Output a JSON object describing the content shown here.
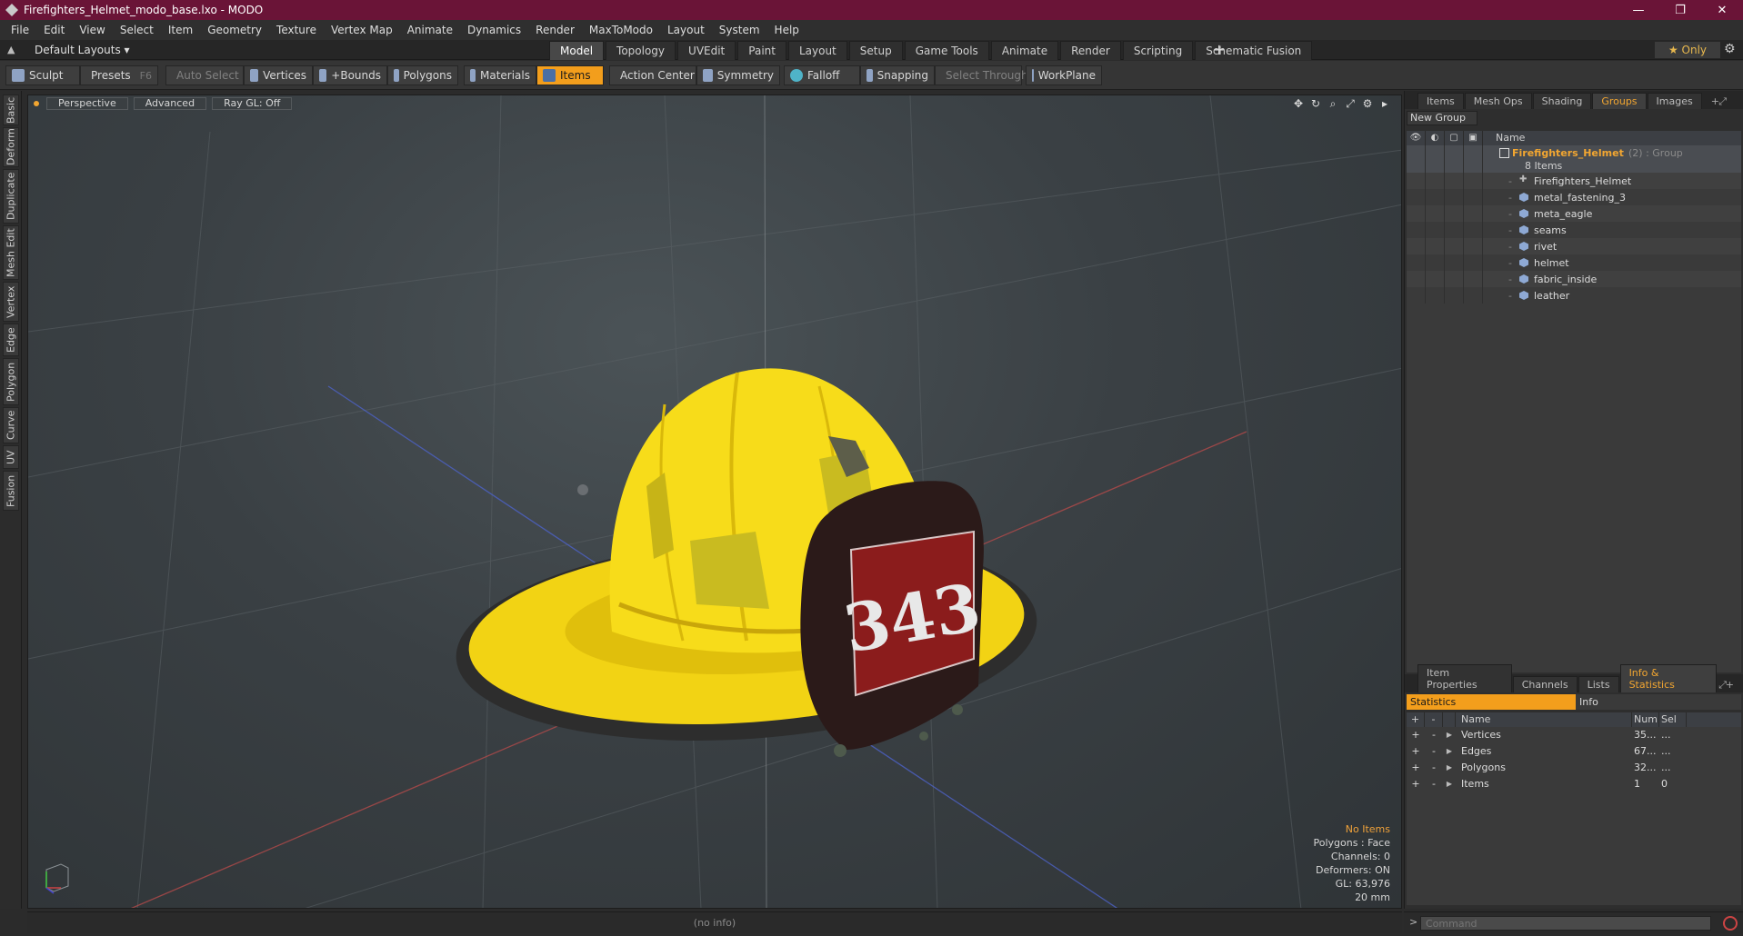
{
  "window": {
    "title": "Firefighters_Helmet_modo_base.lxo - MODO",
    "minimize": "—",
    "maximize": "❐",
    "close": "✕"
  },
  "menu": [
    "File",
    "Edit",
    "View",
    "Select",
    "Item",
    "Geometry",
    "Texture",
    "Vertex Map",
    "Animate",
    "Dynamics",
    "Render",
    "MaxToModo",
    "Layout",
    "System",
    "Help"
  ],
  "layout": {
    "dropdown": "Default Layouts ▾",
    "tabs": [
      "Model",
      "Topology",
      "UVEdit",
      "Paint",
      "Layout",
      "Setup",
      "Game Tools",
      "Animate",
      "Render",
      "Scripting",
      "Schematic Fusion"
    ],
    "active_tab": "Model",
    "plus": "+",
    "only": "★  Only",
    "gear": "⚙"
  },
  "toolbar": {
    "sculpt": "Sculpt",
    "presets": "Presets",
    "presets_key": "F6",
    "auto_select": "Auto Select",
    "vertices": "Vertices",
    "bounds": "+Bounds",
    "polygons": "Polygons",
    "materials": "Materials",
    "items": "Items",
    "action_center": "Action Center",
    "symmetry": "Symmetry",
    "falloff": "Falloff",
    "snapping": "Snapping",
    "select_through": "Select Through",
    "workplane": "WorkPlane"
  },
  "left_tabs": [
    "Basic",
    "Deform",
    "Duplicate",
    "Mesh Edit",
    "Vertex",
    "Edge",
    "Polygon",
    "Curve",
    "UV",
    "Fusion"
  ],
  "viewport": {
    "view": "Perspective",
    "mode": "Advanced",
    "raygl": "Ray GL: Off",
    "icons": [
      "✥",
      "↻",
      "⌕",
      "⤢",
      "⚙",
      "▸"
    ],
    "info": {
      "selection": "No Items",
      "polygons": "Polygons : Face",
      "channels": "Channels: 0",
      "deformers": "Deformers: ON",
      "gl": "GL: 63,976",
      "scale": "20 mm"
    },
    "badge_text": "343"
  },
  "status": "(no info)",
  "groups_panel": {
    "tabs": [
      "Items",
      "Mesh Ops",
      "Shading",
      "Groups",
      "Images"
    ],
    "active_tab": "Groups",
    "plus": "+",
    "expand": "⤢",
    "new_group": "New Group",
    "col_name": "Name",
    "group": {
      "name": "Firefighters_Helmet",
      "count": "(2) : Group",
      "items": "8 Items"
    },
    "children": [
      "Firefighters_Helmet",
      "metal_fastening_3",
      "meta_eagle",
      "seams",
      "rivet",
      "helmet",
      "fabric_inside",
      "leather"
    ]
  },
  "stats_panel": {
    "tabs": [
      "Item Properties",
      "Channels",
      "Lists",
      "Info & Statistics"
    ],
    "active_tab": "Info & Statistics",
    "plus": "+",
    "expand": "⤢",
    "sub_tabs": {
      "statistics": "Statistics",
      "info": "Info"
    },
    "head": {
      "plus": "+",
      "minus": "-",
      "name": "Name",
      "num": "Num",
      "sel": "Sel"
    },
    "rows": [
      {
        "name": "Vertices",
        "num": "35...",
        "sel": "..."
      },
      {
        "name": "Edges",
        "num": "67...",
        "sel": "..."
      },
      {
        "name": "Polygons",
        "num": "32...",
        "sel": "..."
      },
      {
        "name": "Items",
        "num": "1",
        "sel": "0"
      }
    ]
  },
  "command": {
    "prompt": ">",
    "placeholder": "Command"
  }
}
